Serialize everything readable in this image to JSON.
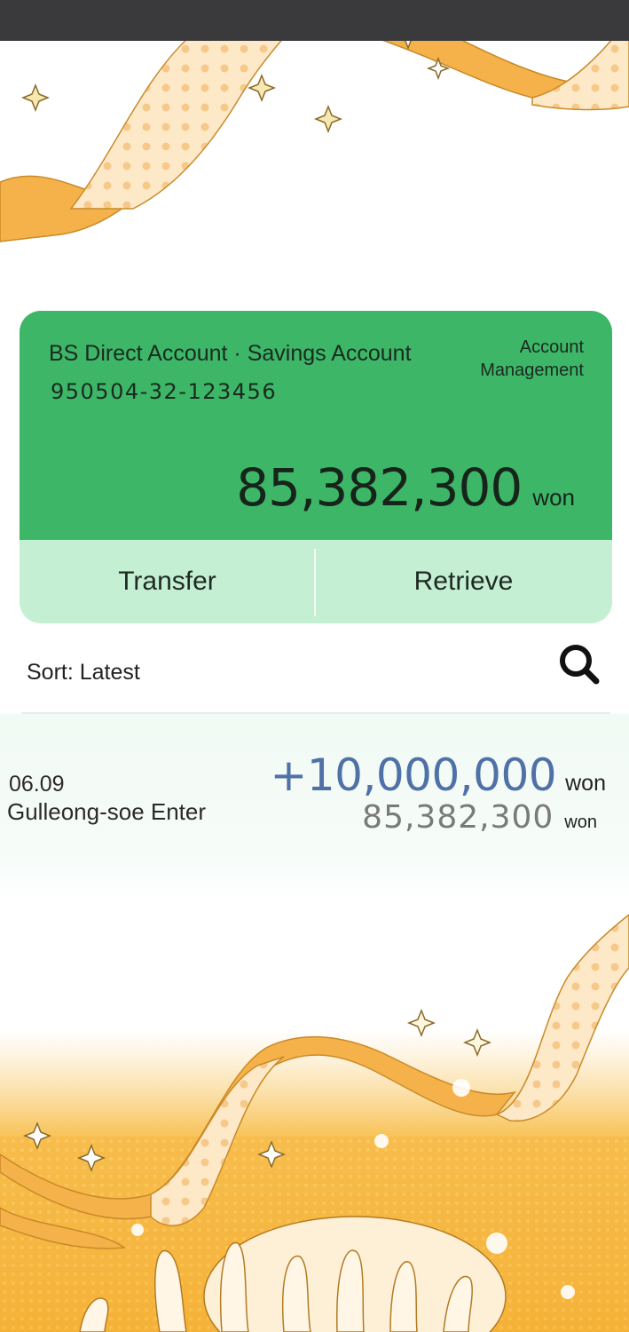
{
  "account": {
    "name": "BS Direct Account · Savings Account",
    "number": "950504-32-123456",
    "management_label": "Account Management",
    "balance": "85,382,300",
    "balance_unit": "won"
  },
  "actions": {
    "transfer_label": "Transfer",
    "retrieve_label": "Retrieve"
  },
  "list": {
    "sort_label": "Sort: Latest",
    "search_icon": "search-icon"
  },
  "transactions": [
    {
      "date": "06.09",
      "description": "Gulleong-soe Enter",
      "amount": "+10,000,000",
      "amount_unit": "won",
      "balance": "85,382,300",
      "balance_unit": "won"
    }
  ],
  "colors": {
    "card_green": "#3db668",
    "card_light": "#c4efd3",
    "amount_blue": "#5071a8",
    "ribbon_orange": "#f5b24a"
  }
}
